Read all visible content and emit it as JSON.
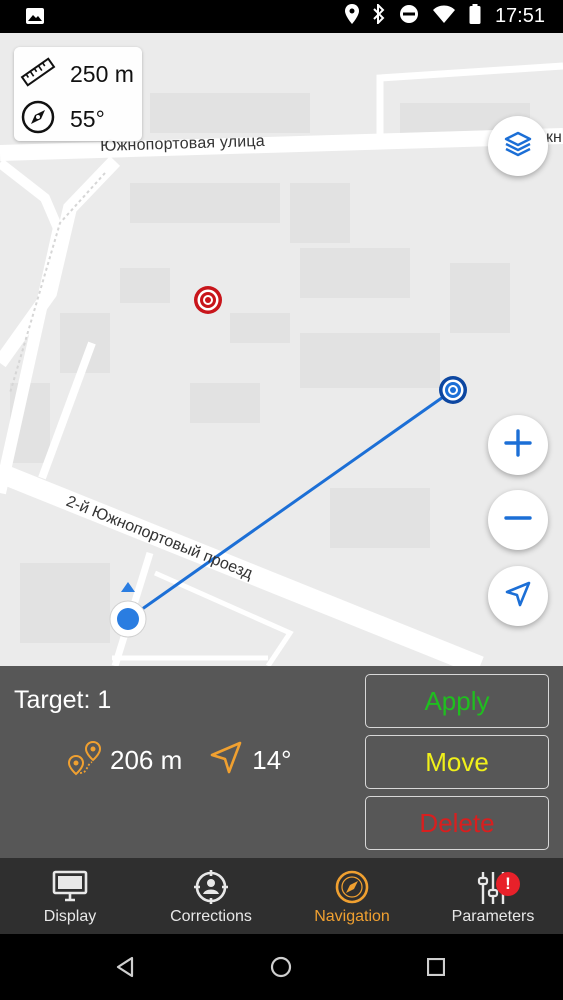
{
  "status_bar": {
    "time": "17:51",
    "icons": [
      "image-icon",
      "location-icon",
      "bluetooth-icon",
      "do-not-disturb-icon",
      "wifi-icon",
      "battery-icon"
    ]
  },
  "map": {
    "scale_label": "250 m",
    "bearing_label": "55°",
    "street_1": "Южнопортовая улица",
    "street_2": "2-й Южнопортовый проезд",
    "street_1_fragment": "кн"
  },
  "panel": {
    "target_label": "Target: 1",
    "distance": "206 m",
    "direction": "14°",
    "apply_label": "Apply",
    "move_label": "Move",
    "delete_label": "Delete",
    "colors": {
      "apply": "#1fbf1f",
      "move": "#f0f01a",
      "delete": "#d81f1f",
      "accent": "#f0a030"
    }
  },
  "tabs": [
    {
      "label": "Display",
      "icon": "monitor-icon"
    },
    {
      "label": "Corrections",
      "icon": "target-person-icon"
    },
    {
      "label": "Navigation",
      "icon": "compass-icon",
      "active": true
    },
    {
      "label": "Parameters",
      "icon": "sliders-icon",
      "badge": "!"
    }
  ]
}
